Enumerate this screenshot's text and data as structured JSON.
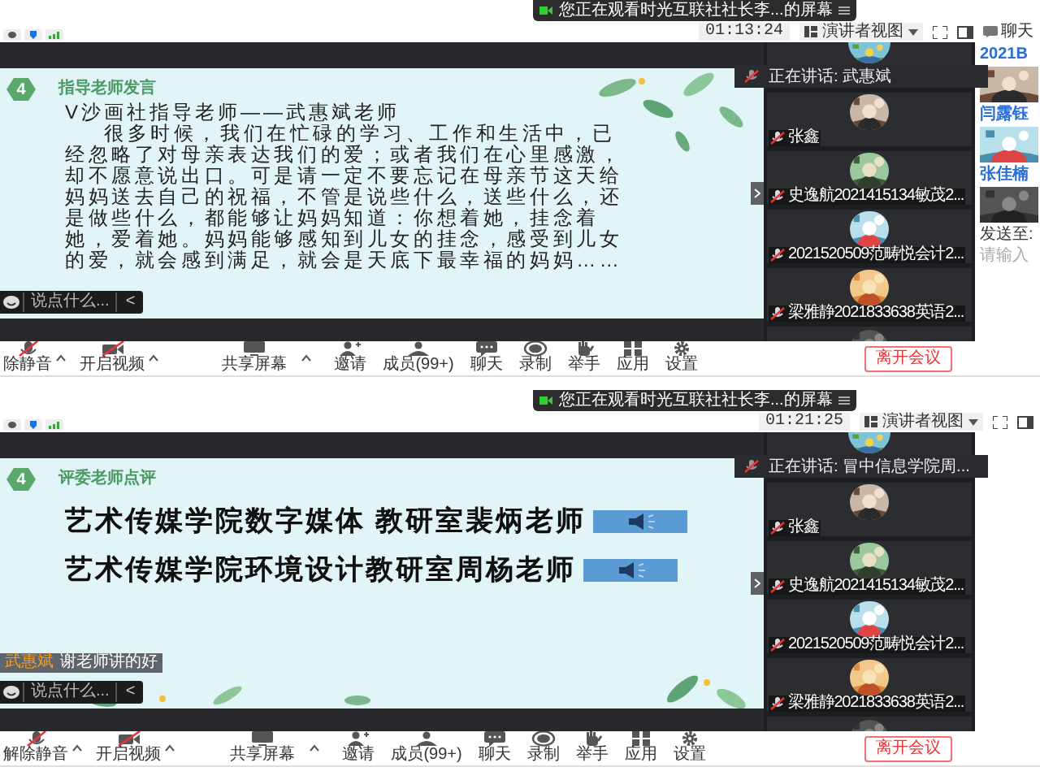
{
  "meetings": [
    {
      "banner": "您正在观看时光互联社社长李...的屏幕",
      "timer": "01:13:24",
      "view_mode": "演讲者视图",
      "chat_tab": "聊天",
      "slide": {
        "kind": "speech",
        "badge": "4",
        "heading": "指导老师发言",
        "title": "V沙画社指导老师——武惠斌老师",
        "paragraph": "很多时候，我们在忙碌的学习、工作和生活中，已经忽略了对母亲表达我们的爱；或者我们在心里感激，却不愿意说出口。可是请一定不要忘记在母亲节这天给妈妈送去自己的祝福，不管是说些什么，送些什么，还是做些什么，都能够让妈妈知道：你想着她，挂念着她，爱着她。妈妈能够感知到儿女的挂念，感受到儿女的爱，就会感到满足，就会是天底下最幸福的妈妈……"
      },
      "speaking": "正在讲话: 武惠斌",
      "participants": [
        {
          "name": "张鑫"
        },
        {
          "name": "史逸航2021415134敏茂2..."
        },
        {
          "name": "2021520509范畴悦会计2..."
        },
        {
          "name": "梁雅静2021833638英语2..."
        }
      ],
      "chat_input": {
        "placeholder": "说点什么...",
        "collapse": "<"
      },
      "toolbar": [
        {
          "kind": "mic",
          "label": "除静音",
          "off": true
        },
        {
          "kind": "camera",
          "label": "开启视频",
          "off": true
        },
        {
          "kind": "share",
          "label": "共享屏幕"
        },
        {
          "kind": "invite",
          "label": "邀请"
        },
        {
          "kind": "members",
          "label": "成员(99+)"
        },
        {
          "kind": "chat",
          "label": "聊天"
        },
        {
          "kind": "record",
          "label": "录制"
        },
        {
          "kind": "hand",
          "label": "举手"
        },
        {
          "kind": "apps",
          "label": "应用"
        },
        {
          "kind": "settings",
          "label": "设置"
        }
      ],
      "leave_button": "离开会议",
      "side_window": [
        {
          "kind": "title",
          "text": "2021B"
        },
        {
          "kind": "thumb"
        },
        {
          "kind": "title",
          "text": "闫露钰"
        },
        {
          "kind": "thumb"
        },
        {
          "kind": "title",
          "text": "张佳楠"
        },
        {
          "kind": "thumb"
        },
        {
          "kind": "label",
          "text": "发送至:"
        },
        {
          "kind": "hint",
          "text": "请输入"
        }
      ]
    },
    {
      "banner": "您正在观看时光互联社社长李...的屏幕",
      "timer": "01:21:25",
      "view_mode": "演讲者视图",
      "slide": {
        "kind": "review",
        "badge": "4",
        "heading": "评委老师点评",
        "lines": [
          "艺术传媒学院数字媒体 教研室裴炳老师",
          "艺术传媒学院环境设计教研室周杨老师"
        ]
      },
      "speaking": "正在讲话: 冒中信息学院周...",
      "participants": [
        {
          "name": "张鑫"
        },
        {
          "name": "史逸航2021415134敏茂2..."
        },
        {
          "name": "2021520509范畴悦会计2..."
        },
        {
          "name": "梁雅静2021833638英语2..."
        }
      ],
      "chat_message": {
        "sender": "武惠斌",
        "text": "谢老师讲的好"
      },
      "chat_input": {
        "placeholder": "说点什么...",
        "collapse": "<"
      },
      "toolbar": [
        {
          "kind": "mic",
          "label": "解除静音",
          "off": true
        },
        {
          "kind": "camera",
          "label": "开启视频",
          "off": true
        },
        {
          "kind": "share",
          "label": "共享屏幕"
        },
        {
          "kind": "invite",
          "label": "邀请"
        },
        {
          "kind": "members",
          "label": "成员(99+)"
        },
        {
          "kind": "chat",
          "label": "聊天"
        },
        {
          "kind": "record",
          "label": "录制"
        },
        {
          "kind": "hand",
          "label": "举手"
        },
        {
          "kind": "apps",
          "label": "应用"
        },
        {
          "kind": "settings",
          "label": "设置"
        }
      ],
      "leave_button": "离开会议"
    }
  ]
}
